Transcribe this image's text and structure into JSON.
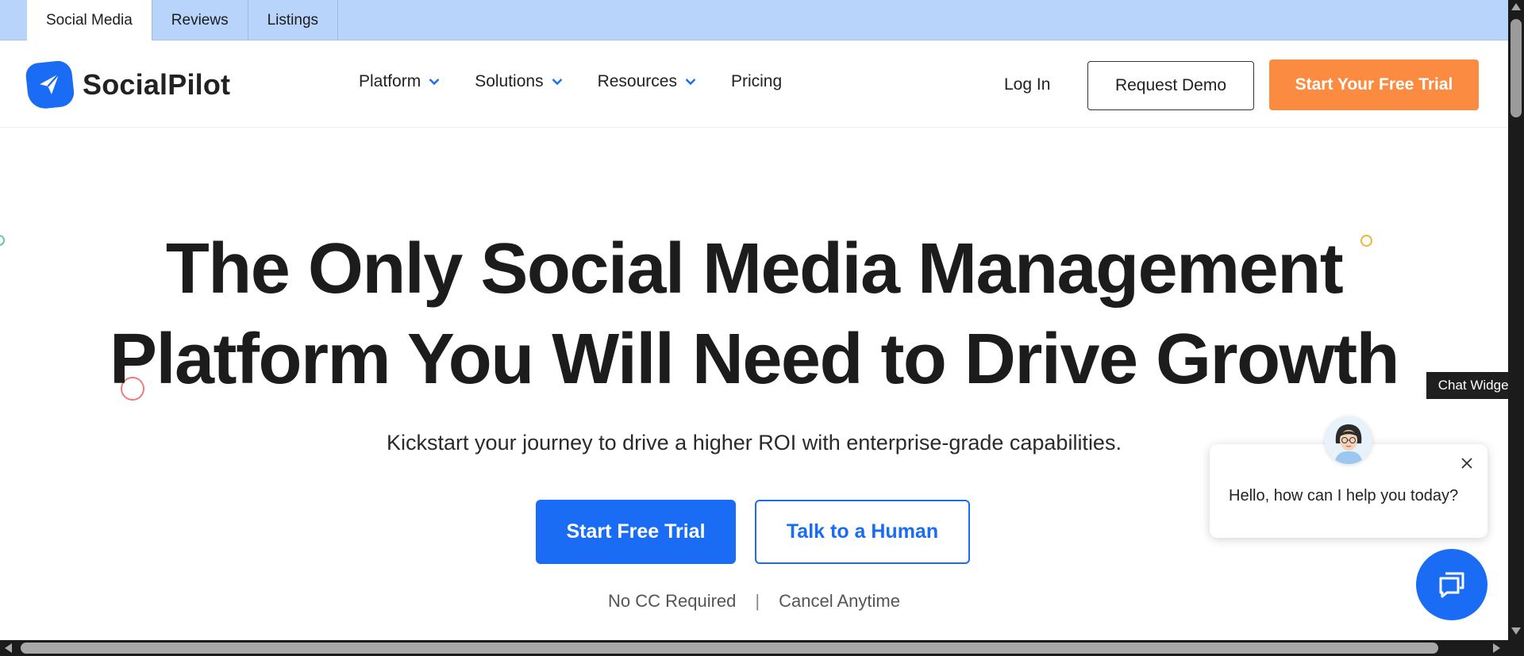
{
  "tabs": [
    {
      "label": "Social Media",
      "active": true
    },
    {
      "label": "Reviews",
      "active": false
    },
    {
      "label": "Listings",
      "active": false
    }
  ],
  "header": {
    "brand": "SocialPilot",
    "nav": [
      {
        "label": "Platform",
        "has_dropdown": true
      },
      {
        "label": "Solutions",
        "has_dropdown": true
      },
      {
        "label": "Resources",
        "has_dropdown": true
      },
      {
        "label": "Pricing",
        "has_dropdown": false
      }
    ],
    "login_label": "Log In",
    "demo_label": "Request Demo",
    "trial_label": "Start Your Free Trial"
  },
  "hero": {
    "title_line1": "The Only Social Media Management",
    "title_line2": "Platform You Will Need to Drive Growth",
    "subtitle": "Kickstart your journey to drive a higher ROI with enterprise-grade capabilities.",
    "primary_cta": "Start Free Trial",
    "secondary_cta": "Talk to a Human",
    "note_left": "No CC Required",
    "note_separator": "|",
    "note_right": "Cancel Anytime"
  },
  "chat": {
    "widget_label": "Chat Widget",
    "greeting": "Hello, how can I help you today?"
  },
  "colors": {
    "brand_blue": "#1a6cf5",
    "accent_orange": "#fb8b40",
    "tab_strip": "#b8d4fb"
  }
}
